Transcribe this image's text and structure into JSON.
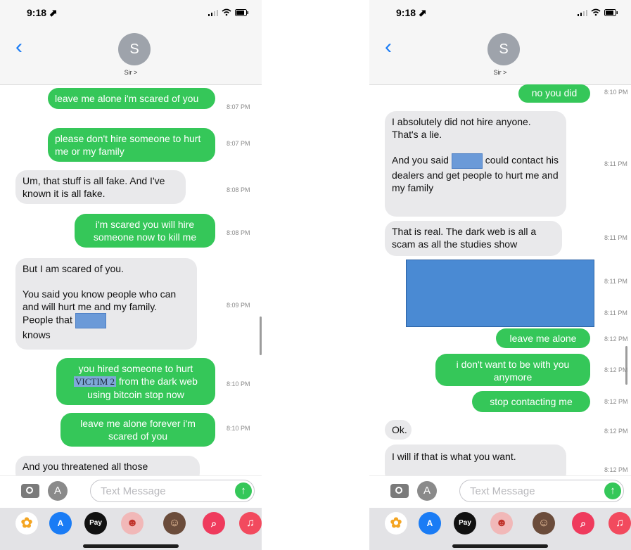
{
  "left": {
    "status": {
      "time": "9:18 ⬈"
    },
    "header": {
      "avatar_initial": "S",
      "contact": "Sir >"
    },
    "messages": [
      {
        "text": "leave me alone i'm scared of you",
        "time": "8:07 PM"
      },
      {
        "text": "please don't hire someone to hurt me or my family",
        "time": "8:07 PM"
      },
      {
        "text": "Um, that stuff is all fake. And I've known it is all fake.",
        "time": "8:08 PM"
      },
      {
        "text": "i'm scared you will hire someone now to kill me",
        "time": "8:08 PM"
      },
      {
        "text_1": "But I am scared of you.\n\nYou said you know people who can and will hurt me and my family.  People that ",
        "text_2": "\nknows",
        "time": "8:09 PM"
      },
      {
        "text_1": "you hired someone to hurt",
        "victim": "VICTIM 2",
        "text_2": "from the dark web using bitcoin stop now",
        "time": "8:10 PM"
      },
      {
        "text": "leave me alone forever i'm scared of you",
        "time": "8:10 PM"
      },
      {
        "text": "And you threatened all those"
      }
    ],
    "input": {
      "placeholder": "Text Message"
    }
  },
  "right": {
    "status": {
      "time": "9:18 ⬈"
    },
    "header": {
      "avatar_initial": "S",
      "contact": "Sir >"
    },
    "messages": [
      {
        "text": "no you did",
        "time": "8:10 PM"
      },
      {
        "text_1": "I absolutely did not hire anyone. That's a lie.\n\nAnd you said",
        "text_2": " could contact his dealers and get people to hurt me and my family",
        "time": "8:11 PM"
      },
      {
        "text": "That is real. The dark web is all a scam as all the studies show",
        "time": "8:11 PM"
      },
      {
        "time_1": "8:11 PM",
        "time_2": "8:11 PM"
      },
      {
        "text": "leave me alone",
        "time": "8:12 PM"
      },
      {
        "text": "i don't want to be with you anymore",
        "time": "8:12 PM"
      },
      {
        "text": "stop contacting me",
        "time": "8:12 PM"
      },
      {
        "text": "Ok.",
        "time": "8:12 PM"
      },
      {
        "text": "I will if that is what you want.",
        "time": "8:12 PM"
      }
    ],
    "input": {
      "placeholder": "Text Message"
    }
  },
  "apps": {
    "apple_pay": "Pay"
  },
  "colors": {
    "outgoing": "#35c759",
    "incoming": "#e9e9eb",
    "accent": "#1a7cf5",
    "redaction": "#4a8ad3"
  }
}
